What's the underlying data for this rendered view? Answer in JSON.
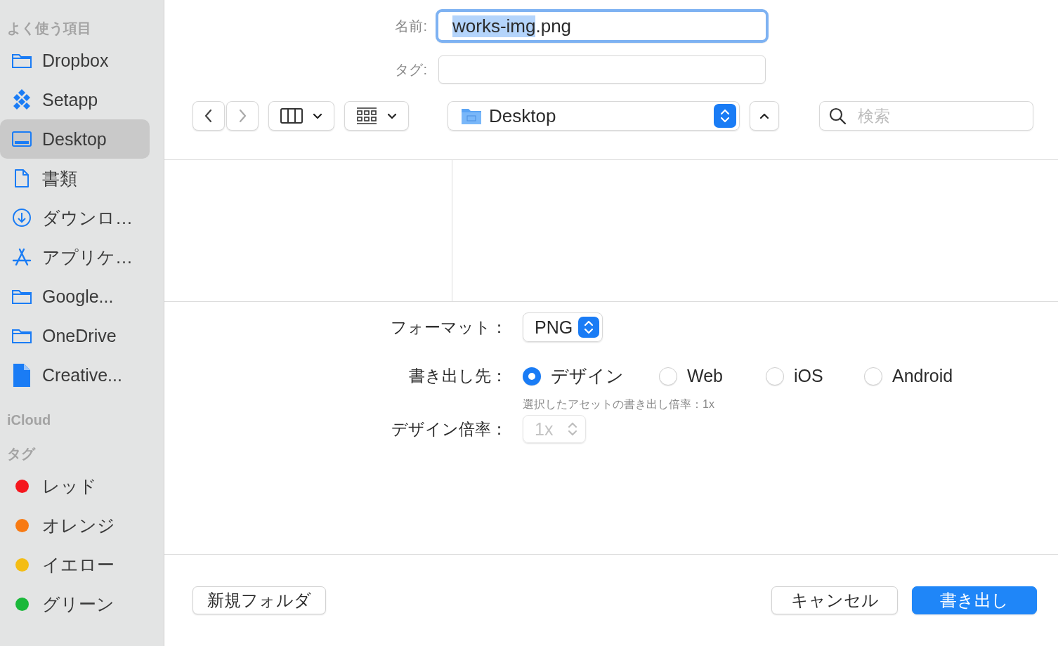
{
  "sidebar": {
    "sections": [
      {
        "title": "よく使う項目",
        "items": [
          {
            "kind": "folder",
            "label": "Dropbox",
            "selected": false
          },
          {
            "kind": "setapp",
            "label": "Setapp",
            "selected": false
          },
          {
            "kind": "desktop",
            "label": "Desktop",
            "selected": true
          },
          {
            "kind": "document",
            "label": "書類",
            "selected": false
          },
          {
            "kind": "download",
            "label": "ダウンロ…",
            "selected": false
          },
          {
            "kind": "apps",
            "label": "アプリケ…",
            "selected": false
          },
          {
            "kind": "folder",
            "label": "Google...",
            "selected": false
          },
          {
            "kind": "folder",
            "label": "OneDrive",
            "selected": false
          },
          {
            "kind": "file",
            "label": "Creative...",
            "selected": false
          }
        ]
      },
      {
        "title": "iCloud"
      },
      {
        "title": "タグ",
        "items": [
          {
            "kind": "tag",
            "label": "レッド",
            "color": "#f5161d",
            "selected": false
          },
          {
            "kind": "tag",
            "label": "オレンジ",
            "color": "#f87a12",
            "selected": false
          },
          {
            "kind": "tag",
            "label": "イエロー",
            "color": "#f4bd14",
            "selected": false
          },
          {
            "kind": "tag",
            "label": "グリーン",
            "color": "#1ab83a",
            "selected": false
          }
        ]
      }
    ]
  },
  "name_field": {
    "label": "名前:",
    "selected_text": "works-img",
    "rest_text": ".png"
  },
  "tag_field": {
    "label": "タグ:"
  },
  "toolbar": {
    "back": {
      "disabled": false
    },
    "forward": {
      "disabled": true
    },
    "location": "Desktop",
    "search": {
      "placeholder": "検索"
    }
  },
  "options": {
    "format": {
      "label": "フォーマット：",
      "value": "PNG"
    },
    "destination": {
      "label": "書き出し先：",
      "choices": [
        {
          "label": "デザイン",
          "selected": true
        },
        {
          "label": "Web",
          "selected": false
        },
        {
          "label": "iOS",
          "selected": false
        },
        {
          "label": "Android",
          "selected": false
        }
      ],
      "note": "選択したアセットの書き出し倍率：1x"
    },
    "scale": {
      "label": "デザイン倍率：",
      "value": "1x",
      "disabled": true
    }
  },
  "buttons": {
    "new_folder": "新規フォルダ",
    "cancel": "キャンセル",
    "export": "書き出し"
  }
}
